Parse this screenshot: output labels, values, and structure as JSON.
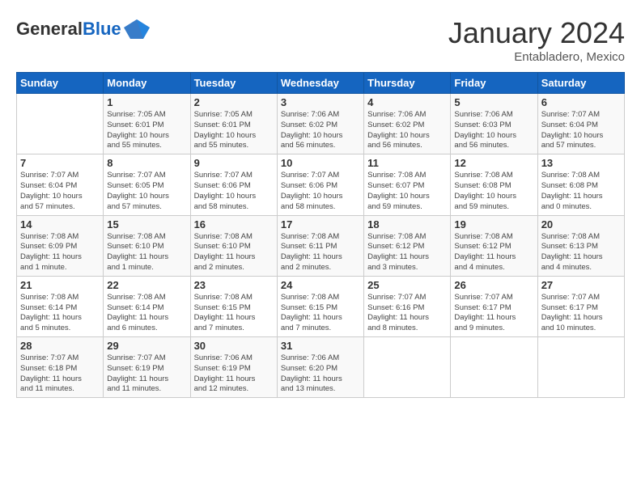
{
  "header": {
    "logo_general": "General",
    "logo_blue": "Blue",
    "month_title": "January 2024",
    "location": "Entabladero, Mexico"
  },
  "weekdays": [
    "Sunday",
    "Monday",
    "Tuesday",
    "Wednesday",
    "Thursday",
    "Friday",
    "Saturday"
  ],
  "weeks": [
    [
      {
        "day": "",
        "info": ""
      },
      {
        "day": "1",
        "info": "Sunrise: 7:05 AM\nSunset: 6:01 PM\nDaylight: 10 hours\nand 55 minutes."
      },
      {
        "day": "2",
        "info": "Sunrise: 7:05 AM\nSunset: 6:01 PM\nDaylight: 10 hours\nand 55 minutes."
      },
      {
        "day": "3",
        "info": "Sunrise: 7:06 AM\nSunset: 6:02 PM\nDaylight: 10 hours\nand 56 minutes."
      },
      {
        "day": "4",
        "info": "Sunrise: 7:06 AM\nSunset: 6:02 PM\nDaylight: 10 hours\nand 56 minutes."
      },
      {
        "day": "5",
        "info": "Sunrise: 7:06 AM\nSunset: 6:03 PM\nDaylight: 10 hours\nand 56 minutes."
      },
      {
        "day": "6",
        "info": "Sunrise: 7:07 AM\nSunset: 6:04 PM\nDaylight: 10 hours\nand 57 minutes."
      }
    ],
    [
      {
        "day": "7",
        "info": "Sunrise: 7:07 AM\nSunset: 6:04 PM\nDaylight: 10 hours\nand 57 minutes."
      },
      {
        "day": "8",
        "info": "Sunrise: 7:07 AM\nSunset: 6:05 PM\nDaylight: 10 hours\nand 57 minutes."
      },
      {
        "day": "9",
        "info": "Sunrise: 7:07 AM\nSunset: 6:06 PM\nDaylight: 10 hours\nand 58 minutes."
      },
      {
        "day": "10",
        "info": "Sunrise: 7:07 AM\nSunset: 6:06 PM\nDaylight: 10 hours\nand 58 minutes."
      },
      {
        "day": "11",
        "info": "Sunrise: 7:08 AM\nSunset: 6:07 PM\nDaylight: 10 hours\nand 59 minutes."
      },
      {
        "day": "12",
        "info": "Sunrise: 7:08 AM\nSunset: 6:08 PM\nDaylight: 10 hours\nand 59 minutes."
      },
      {
        "day": "13",
        "info": "Sunrise: 7:08 AM\nSunset: 6:08 PM\nDaylight: 11 hours\nand 0 minutes."
      }
    ],
    [
      {
        "day": "14",
        "info": "Sunrise: 7:08 AM\nSunset: 6:09 PM\nDaylight: 11 hours\nand 1 minute."
      },
      {
        "day": "15",
        "info": "Sunrise: 7:08 AM\nSunset: 6:10 PM\nDaylight: 11 hours\nand 1 minute."
      },
      {
        "day": "16",
        "info": "Sunrise: 7:08 AM\nSunset: 6:10 PM\nDaylight: 11 hours\nand 2 minutes."
      },
      {
        "day": "17",
        "info": "Sunrise: 7:08 AM\nSunset: 6:11 PM\nDaylight: 11 hours\nand 2 minutes."
      },
      {
        "day": "18",
        "info": "Sunrise: 7:08 AM\nSunset: 6:12 PM\nDaylight: 11 hours\nand 3 minutes."
      },
      {
        "day": "19",
        "info": "Sunrise: 7:08 AM\nSunset: 6:12 PM\nDaylight: 11 hours\nand 4 minutes."
      },
      {
        "day": "20",
        "info": "Sunrise: 7:08 AM\nSunset: 6:13 PM\nDaylight: 11 hours\nand 4 minutes."
      }
    ],
    [
      {
        "day": "21",
        "info": "Sunrise: 7:08 AM\nSunset: 6:14 PM\nDaylight: 11 hours\nand 5 minutes."
      },
      {
        "day": "22",
        "info": "Sunrise: 7:08 AM\nSunset: 6:14 PM\nDaylight: 11 hours\nand 6 minutes."
      },
      {
        "day": "23",
        "info": "Sunrise: 7:08 AM\nSunset: 6:15 PM\nDaylight: 11 hours\nand 7 minutes."
      },
      {
        "day": "24",
        "info": "Sunrise: 7:08 AM\nSunset: 6:15 PM\nDaylight: 11 hours\nand 7 minutes."
      },
      {
        "day": "25",
        "info": "Sunrise: 7:07 AM\nSunset: 6:16 PM\nDaylight: 11 hours\nand 8 minutes."
      },
      {
        "day": "26",
        "info": "Sunrise: 7:07 AM\nSunset: 6:17 PM\nDaylight: 11 hours\nand 9 minutes."
      },
      {
        "day": "27",
        "info": "Sunrise: 7:07 AM\nSunset: 6:17 PM\nDaylight: 11 hours\nand 10 minutes."
      }
    ],
    [
      {
        "day": "28",
        "info": "Sunrise: 7:07 AM\nSunset: 6:18 PM\nDaylight: 11 hours\nand 11 minutes."
      },
      {
        "day": "29",
        "info": "Sunrise: 7:07 AM\nSunset: 6:19 PM\nDaylight: 11 hours\nand 11 minutes."
      },
      {
        "day": "30",
        "info": "Sunrise: 7:06 AM\nSunset: 6:19 PM\nDaylight: 11 hours\nand 12 minutes."
      },
      {
        "day": "31",
        "info": "Sunrise: 7:06 AM\nSunset: 6:20 PM\nDaylight: 11 hours\nand 13 minutes."
      },
      {
        "day": "",
        "info": ""
      },
      {
        "day": "",
        "info": ""
      },
      {
        "day": "",
        "info": ""
      }
    ]
  ]
}
